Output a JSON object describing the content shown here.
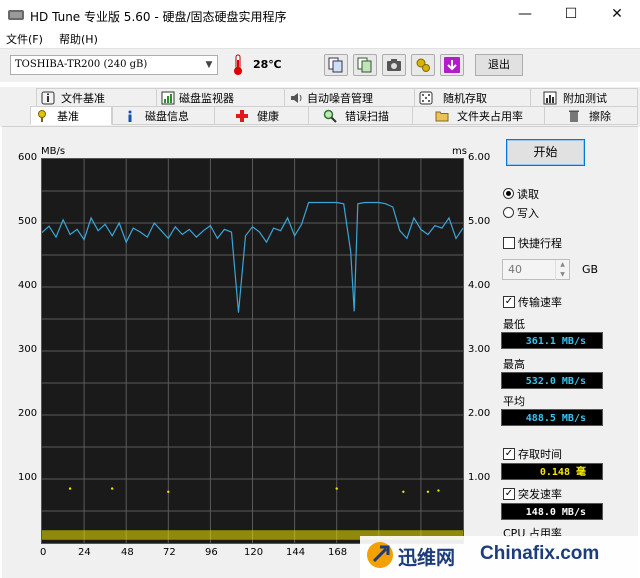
{
  "window": {
    "title": "HD Tune 专业版 5.60 - 硬盘/固态硬盘实用程序",
    "minimize": "—",
    "maximize": "☐",
    "close": "✕"
  },
  "menu": {
    "file": "文件(F)",
    "help": "帮助(H)"
  },
  "toolbar": {
    "drive": "TOSHIBA-TR200 (240 gB)",
    "temperature": "28℃",
    "exit_label": "退出",
    "icons": [
      "copy-icon",
      "copy-report-icon",
      "camera-icon",
      "tools-icon",
      "save-icon"
    ]
  },
  "tabs_row1": [
    {
      "label": "文件基准",
      "icon": "info-icon"
    },
    {
      "label": "磁盘监视器",
      "icon": "monitor-chart-icon"
    },
    {
      "label": "自动噪音管理",
      "icon": "speaker-icon"
    },
    {
      "label": "随机存取",
      "icon": "dice-icon"
    },
    {
      "label": "附加测试",
      "icon": "chart-icon"
    }
  ],
  "tabs_row2": [
    {
      "label": "基准",
      "icon": "benchmark-icon",
      "active": true
    },
    {
      "label": "磁盘信息",
      "icon": "info-icon",
      "active": false
    },
    {
      "label": "健康",
      "icon": "health-cross-icon",
      "active": false
    },
    {
      "label": "错误扫描",
      "icon": "magnifier-icon",
      "active": false
    },
    {
      "label": "文件夹占用率",
      "icon": "folder-icon",
      "active": false
    },
    {
      "label": "擦除",
      "icon": "trash-icon",
      "active": false
    }
  ],
  "controls": {
    "start_label": "开始",
    "read_label": "读取",
    "write_label": "写入",
    "mode": "read",
    "short_stroke_label": "快捷行程",
    "short_stroke_checked": false,
    "short_stroke_value": "40",
    "short_stroke_unit": "GB",
    "transfer_rate_label": "传输速率",
    "transfer_rate_checked": true,
    "min_label": "最低",
    "min_value": "361.1 MB/s",
    "max_label": "最高",
    "max_value": "532.0 MB/s",
    "avg_label": "平均",
    "avg_value": "488.5 MB/s",
    "access_time_label": "存取时间",
    "access_time_checked": true,
    "access_time_value": "0.148 毫",
    "burst_rate_label": "突发速率",
    "burst_rate_checked": true,
    "burst_rate_value": "148.0 MB/s",
    "cpu_label": "CPU 占用率"
  },
  "chart_data": {
    "type": "line",
    "ylabel_left": "MB/s",
    "ylabel_right": "ms",
    "ylim_left": [
      0,
      600
    ],
    "ylim_right": [
      0,
      6
    ],
    "yticks_left": [
      "600",
      "500",
      "400",
      "300",
      "200",
      "100"
    ],
    "yticks_right": [
      "6.00",
      "5.00",
      "4.00",
      "3.00",
      "2.00",
      "1.00"
    ],
    "xticks": [
      "0",
      "24",
      "48",
      "72",
      "96",
      "120",
      "144",
      "168",
      "192"
    ],
    "xlim": [
      0,
      240
    ],
    "grid": true,
    "series": [
      {
        "color": "#3aa6d8",
        "x": [
          0,
          4,
          8,
          12,
          16,
          20,
          24,
          28,
          32,
          36,
          40,
          44,
          48,
          52,
          56,
          60,
          64,
          68,
          72,
          76,
          80,
          84,
          88,
          92,
          96,
          100,
          104,
          108,
          112,
          116,
          120,
          124,
          128,
          132,
          136,
          140,
          144,
          148,
          152,
          156,
          160,
          164,
          168,
          172,
          176,
          178,
          180,
          184,
          188,
          192,
          196,
          200,
          204,
          208,
          212,
          216,
          220,
          224,
          228,
          232,
          236,
          240
        ],
        "values": [
          485,
          495,
          478,
          505,
          482,
          490,
          474,
          508,
          488,
          498,
          480,
          500,
          470,
          492,
          486,
          478,
          500,
          488,
          476,
          494,
          482,
          490,
          478,
          488,
          496,
          476,
          490,
          486,
          360,
          480,
          494,
          486,
          470,
          492,
          488,
          508,
          480,
          498,
          532,
          532,
          532,
          532,
          532,
          530,
          455,
          362,
          530,
          532,
          532,
          532,
          530,
          525,
          488,
          476,
          508,
          490,
          482,
          496,
          492,
          508,
          476,
          492
        ]
      }
    ],
    "access_points": {
      "color": "#f2e600",
      "x": [
        16,
        40,
        72,
        168,
        206,
        220,
        226
      ],
      "values": [
        0.85,
        0.85,
        0.8,
        0.85,
        0.8,
        0.8,
        0.82
      ]
    }
  },
  "watermark": {
    "cn": "迅维网",
    "en": "Chinafix.com"
  }
}
